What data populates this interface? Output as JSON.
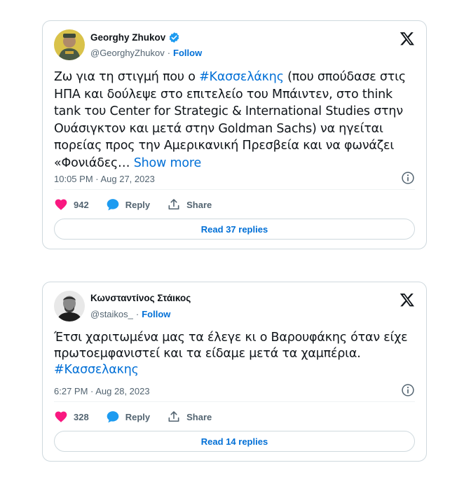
{
  "tweets": [
    {
      "author_name": "Georghy Zhukov",
      "verified": true,
      "handle": "@GeorghyZhukov",
      "separator": "·",
      "follow_label": "Follow",
      "text_lines": [
        {
          "segments": [
            {
              "t": "Ζω για τη στιγμή που ο ",
              "type": "text"
            },
            {
              "t": "#Κασσελάκης",
              "type": "hashtag"
            },
            {
              "t": " (που σπούδασε στις",
              "type": "text"
            }
          ]
        },
        {
          "segments": [
            {
              "t": "ΗΠΑ και δούλεψε στο επιτελείο του Μπάιντεν, στο think",
              "type": "text"
            }
          ]
        },
        {
          "segments": [
            {
              "t": "tank του Center for Strategic & International Studies στην",
              "type": "text"
            }
          ]
        },
        {
          "segments": [
            {
              "t": "Ουάσιγκτον και μετά στην Goldman Sachs) να ηγείται",
              "type": "text"
            }
          ]
        },
        {
          "segments": [
            {
              "t": "πορείας προς την Αμερικανική Πρεσβεία και να φωνάζει",
              "type": "text"
            }
          ]
        },
        {
          "segments": [
            {
              "t": "«Φονιάδες… ",
              "type": "text"
            },
            {
              "t": "Show more",
              "type": "showmore"
            }
          ]
        }
      ],
      "timestamp": "10:05 PM · Aug 27, 2023",
      "likes": "942",
      "reply_label": "Reply",
      "share_label": "Share",
      "read_replies_label": "Read 37 replies"
    },
    {
      "author_name": "Κωνσταντίνος Στάικος",
      "verified": false,
      "handle": "@staikos_",
      "separator": "·",
      "follow_label": "Follow",
      "text_lines": [
        {
          "segments": [
            {
              "t": "Έτσι χαριτωμένα μας τα έλεγε κι ο Βαρουφάκης όταν είχε",
              "type": "text"
            }
          ]
        },
        {
          "segments": [
            {
              "t": "πρωτοεμφανιστεί και τα είδαμε μετά τα χαμπέρια.",
              "type": "text"
            }
          ]
        },
        {
          "segments": [
            {
              "t": "#Κασσελακης",
              "type": "hashtag"
            }
          ]
        }
      ],
      "timestamp": "6:27 PM · Aug 28, 2023",
      "likes": "328",
      "reply_label": "Reply",
      "share_label": "Share",
      "read_replies_label": "Read 14 replies"
    }
  ],
  "colors": {
    "link": "#006fd6",
    "heart": "#f91880",
    "reply_bubble": "#1d9bf0",
    "verified": "#1d9bf0",
    "muted": "#536471",
    "border": "#cfd9de"
  },
  "icons": {
    "verified": "verified-badge-icon",
    "brand": "x-logo-icon",
    "info": "info-icon",
    "like": "heart-icon",
    "reply": "reply-bubble-icon",
    "share": "share-icon"
  }
}
